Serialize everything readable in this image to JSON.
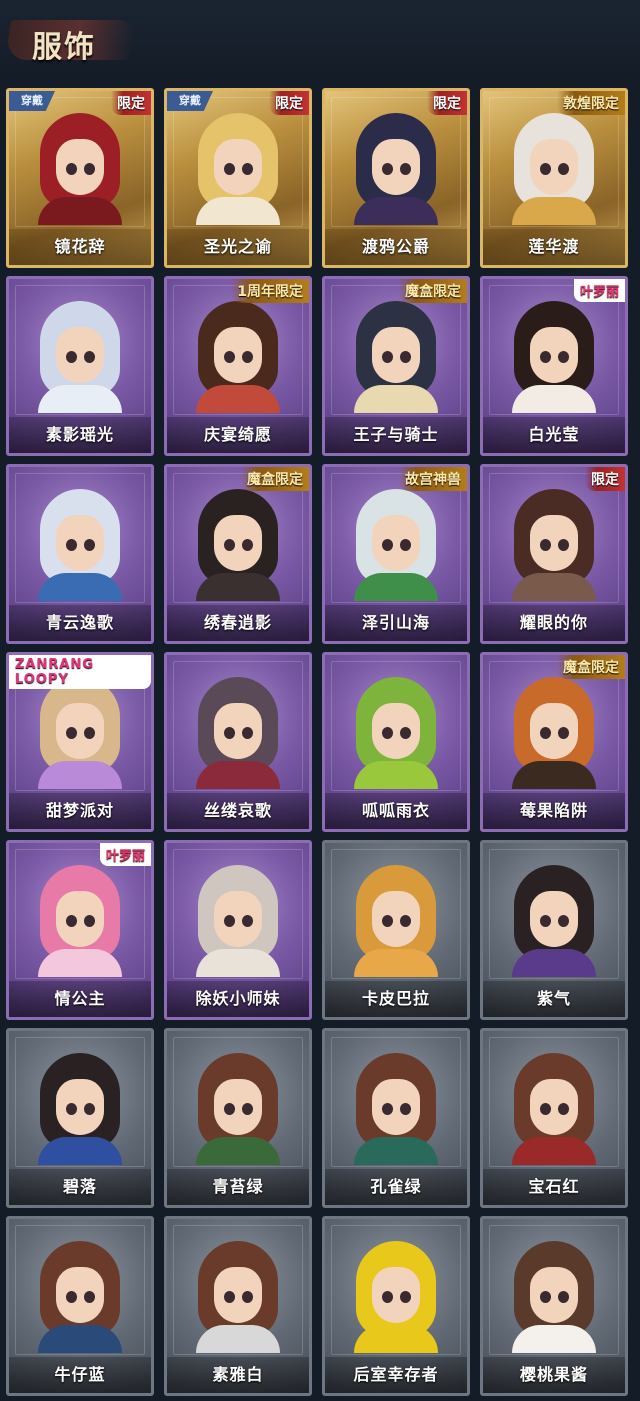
{
  "header": {
    "title": "服饰"
  },
  "wear_label": "穿戴",
  "colors": {
    "background": "#141c27",
    "gold_card": "#c8a252",
    "purple_card": "#7b5aa6",
    "gray_card": "#626a75",
    "limited_tag": "#c23333"
  },
  "outfits": [
    {
      "name": "镜花辞",
      "tier": "gold",
      "tag": "限定",
      "tag_style": "red",
      "worn": true,
      "hair": "#9b1f24",
      "body": "#7a1a1f"
    },
    {
      "name": "圣光之谕",
      "tier": "gold",
      "tag": "限定",
      "tag_style": "red",
      "worn": true,
      "hair": "#e4c36b",
      "body": "#f1e6cf"
    },
    {
      "name": "渡鸦公爵",
      "tier": "gold",
      "tag": "限定",
      "tag_style": "red",
      "worn": false,
      "hair": "#2a2c4a",
      "body": "#3b2e5a"
    },
    {
      "name": "莲华渡",
      "tier": "gold",
      "tag": "敦煌限定",
      "tag_style": "yellow",
      "worn": false,
      "hair": "#e8e2dc",
      "body": "#d9a84a"
    },
    {
      "name": "素影瑶光",
      "tier": "purple",
      "tag": "",
      "tag_style": "",
      "worn": false,
      "hair": "#cfd8e8",
      "body": "#e8eef6"
    },
    {
      "name": "庆宴绮愿",
      "tier": "purple",
      "tag": "1周年限定",
      "tag_style": "yellow",
      "worn": false,
      "hair": "#4a2a1c",
      "body": "#c24a3a"
    },
    {
      "name": "王子与骑士",
      "tier": "purple",
      "tag": "魔盒限定",
      "tag_style": "yellow",
      "worn": false,
      "hair": "#2c3244",
      "body": "#e8d9b0"
    },
    {
      "name": "白光莹",
      "tier": "purple",
      "tag": "叶罗丽",
      "tag_style": "pink",
      "worn": false,
      "hair": "#2a1c18",
      "body": "#f3ece4"
    },
    {
      "name": "青云逸歌",
      "tier": "purple",
      "tag": "",
      "tag_style": "",
      "worn": false,
      "hair": "#d8e0ee",
      "body": "#3a6cb4"
    },
    {
      "name": "绣春逍影",
      "tier": "purple",
      "tag": "魔盒限定",
      "tag_style": "yellow",
      "worn": false,
      "hair": "#2a2220",
      "body": "#3a3030"
    },
    {
      "name": "泽引山海",
      "tier": "purple",
      "tag": "故宫神兽",
      "tag_style": "yellow",
      "worn": false,
      "hair": "#d9e2e4",
      "body": "#3f8f4a"
    },
    {
      "name": "耀眼的你",
      "tier": "purple",
      "tag": "限定",
      "tag_style": "red",
      "worn": false,
      "hair": "#4a2c24",
      "body": "#7a5a4a"
    },
    {
      "name": "甜梦派对",
      "tier": "purple",
      "tag": "ZANRANG LOOPY",
      "tag_style": "loopy",
      "worn": false,
      "hair": "#d8b88a",
      "body": "#b88ad8"
    },
    {
      "name": "丝缕哀歌",
      "tier": "purple",
      "tag": "",
      "tag_style": "",
      "worn": false,
      "hair": "#5a4a58",
      "body": "#8a2a3a"
    },
    {
      "name": "呱呱雨衣",
      "tier": "purple",
      "tag": "",
      "tag_style": "",
      "worn": false,
      "hair": "#7fb43c",
      "body": "#9ac83c"
    },
    {
      "name": "莓果陷阱",
      "tier": "purple",
      "tag": "魔盒限定",
      "tag_style": "yellow",
      "worn": false,
      "hair": "#c86a2a",
      "body": "#3a2a20"
    },
    {
      "name": "情公主",
      "tier": "purple",
      "tag": "叶罗丽",
      "tag_style": "pink",
      "worn": false,
      "hair": "#e87aa8",
      "body": "#f4c8dc"
    },
    {
      "name": "除妖小师妹",
      "tier": "purple",
      "tag": "",
      "tag_style": "",
      "worn": false,
      "hair": "#cfc6c0",
      "body": "#e8e2d8"
    },
    {
      "name": "卡皮巴拉",
      "tier": "gray",
      "tag": "",
      "tag_style": "",
      "worn": false,
      "hair": "#d89a3a",
      "body": "#e8a84a"
    },
    {
      "name": "紫气",
      "tier": "gray",
      "tag": "",
      "tag_style": "",
      "worn": false,
      "hair": "#2a2222",
      "body": "#5a3a8a"
    },
    {
      "name": "碧落",
      "tier": "gray",
      "tag": "",
      "tag_style": "",
      "worn": false,
      "hair": "#2a2222",
      "body": "#2f4fa0"
    },
    {
      "name": "青苔绿",
      "tier": "gray",
      "tag": "",
      "tag_style": "",
      "worn": false,
      "hair": "#6a3a2a",
      "body": "#3a6a3a"
    },
    {
      "name": "孔雀绿",
      "tier": "gray",
      "tag": "",
      "tag_style": "",
      "worn": false,
      "hair": "#6a3a2a",
      "body": "#2a6a5a"
    },
    {
      "name": "宝石红",
      "tier": "gray",
      "tag": "",
      "tag_style": "",
      "worn": false,
      "hair": "#6a3a2a",
      "body": "#9a2a2a"
    },
    {
      "name": "牛仔蓝",
      "tier": "gray",
      "tag": "",
      "tag_style": "",
      "worn": false,
      "hair": "#6a3a2a",
      "body": "#2a4a7a"
    },
    {
      "name": "素雅白",
      "tier": "gray",
      "tag": "",
      "tag_style": "",
      "worn": false,
      "hair": "#6a3a2a",
      "body": "#d8d8d8"
    },
    {
      "name": "后室幸存者",
      "tier": "gray",
      "tag": "",
      "tag_style": "",
      "worn": false,
      "hair": "#e8c81a",
      "body": "#e8c81a"
    },
    {
      "name": "樱桃果酱",
      "tier": "gray",
      "tag": "",
      "tag_style": "",
      "worn": false,
      "hair": "#5a3a2a",
      "body": "#f4f0ec"
    }
  ]
}
